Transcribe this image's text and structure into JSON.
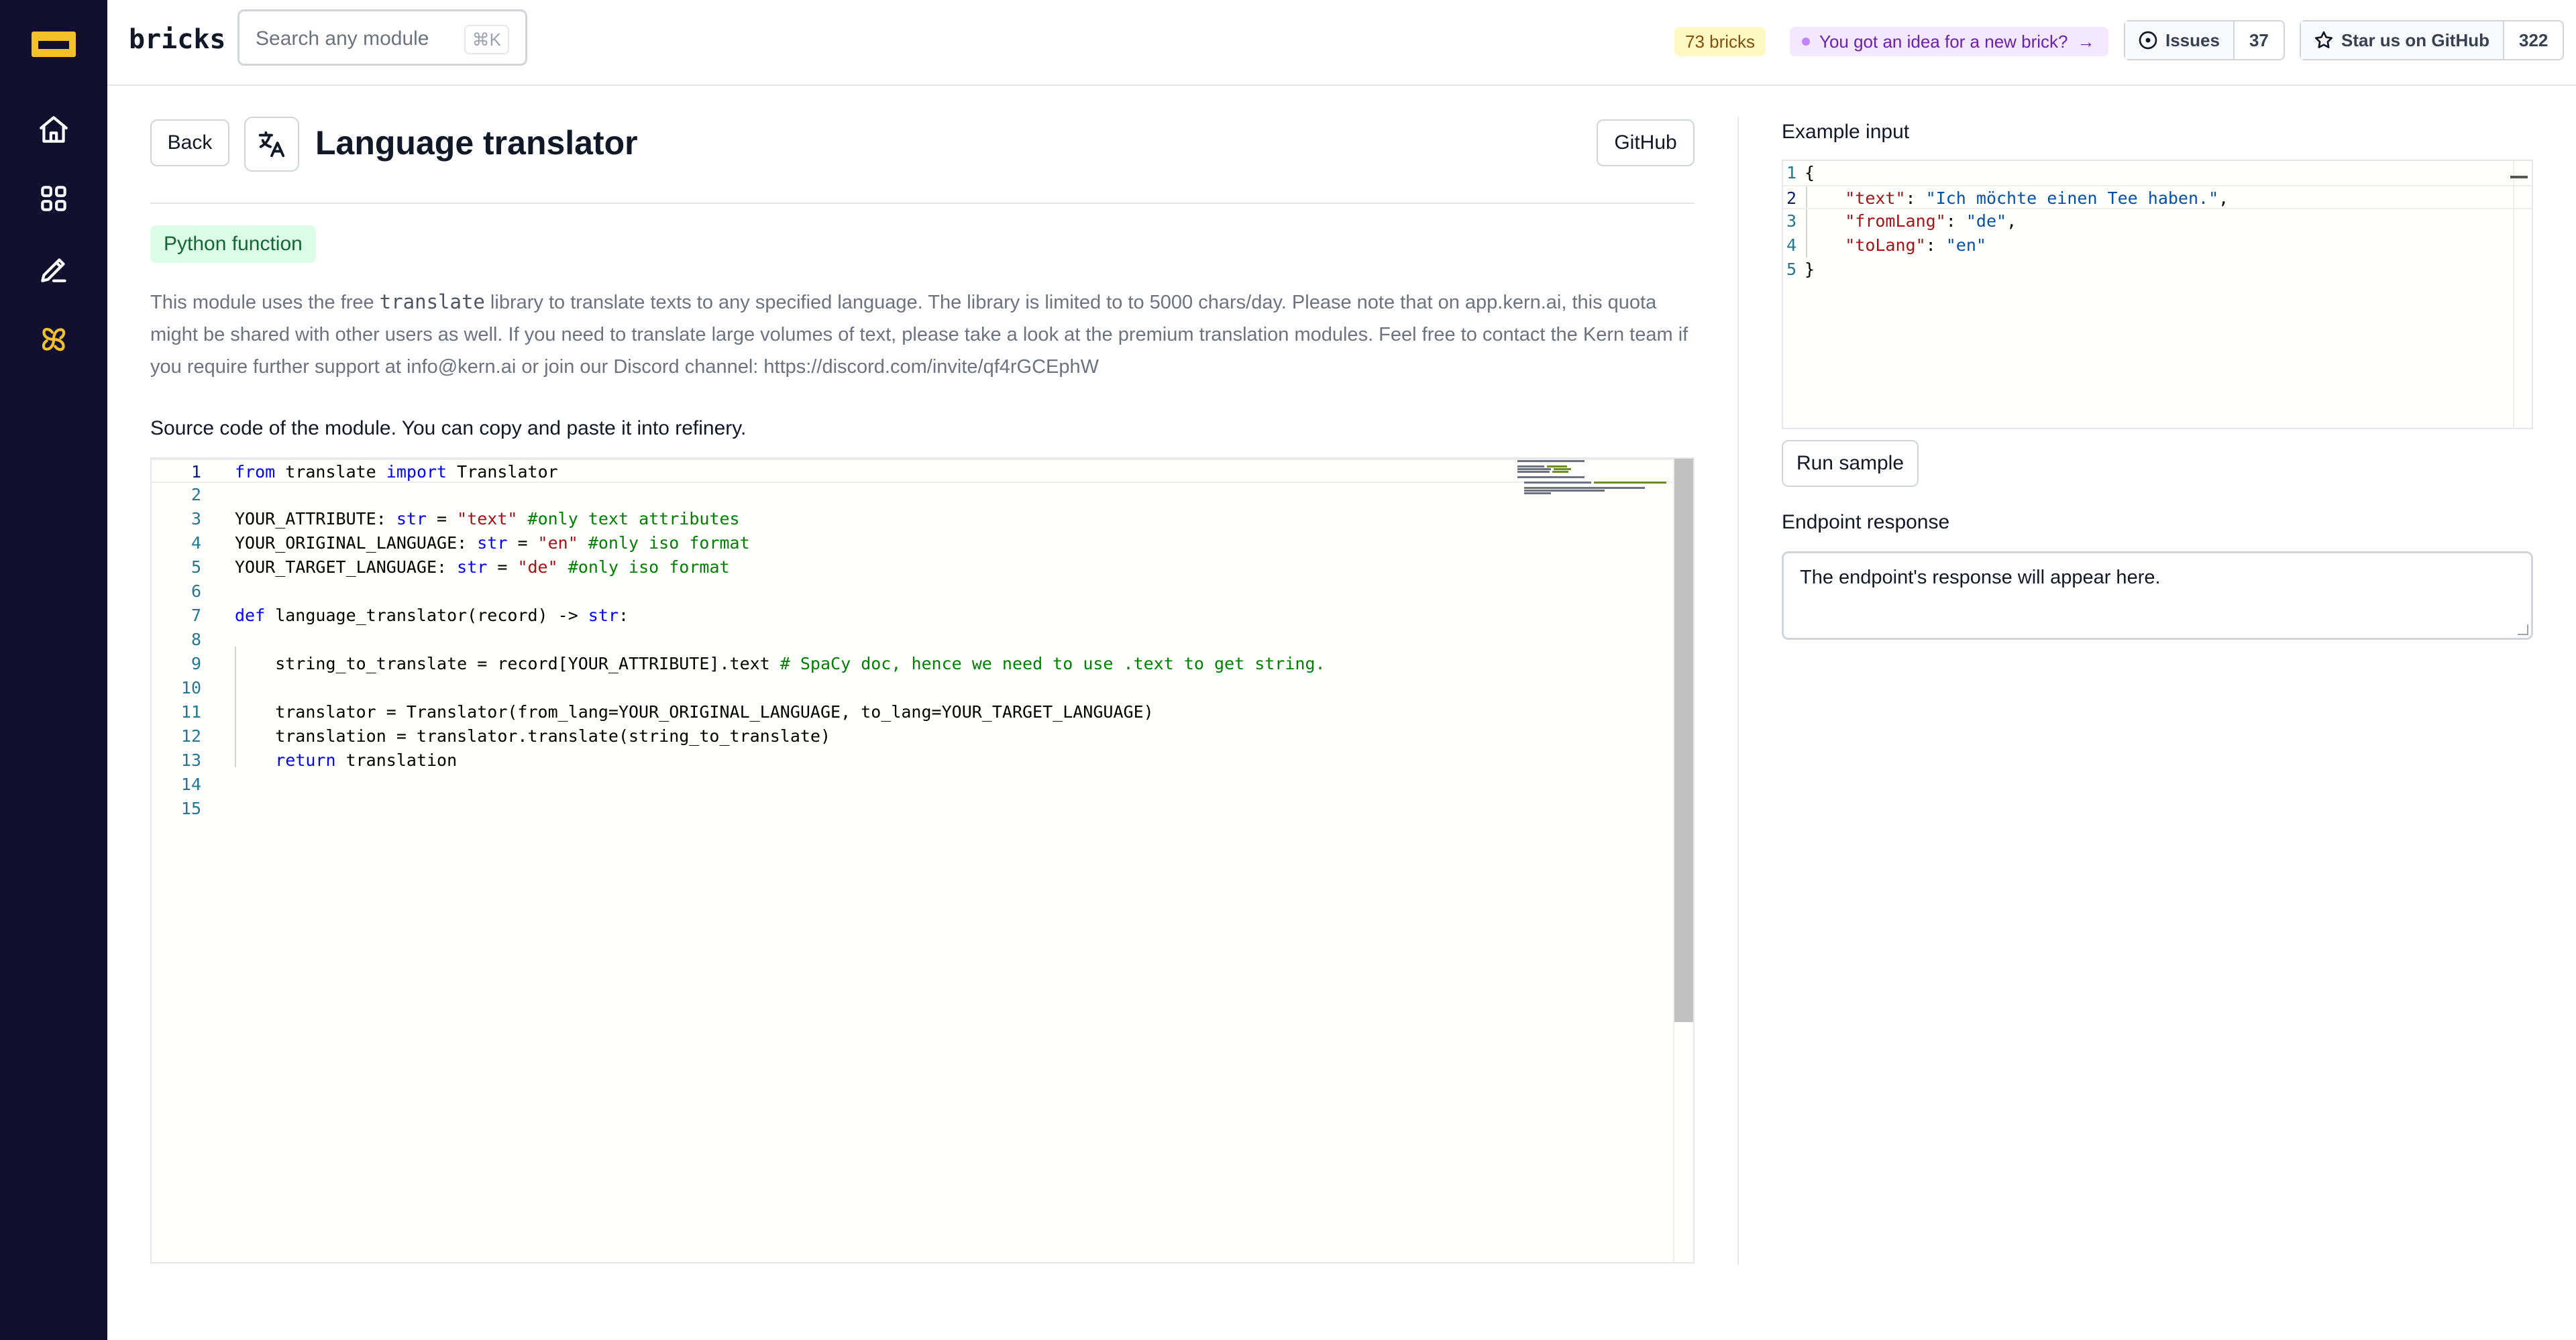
{
  "app": {
    "brand": "bricks"
  },
  "search": {
    "placeholder": "Search any module",
    "shortcut": "⌘K"
  },
  "header": {
    "bricks_count": "73 bricks",
    "idea_text": "You got an idea for a new brick?",
    "idea_arrow": "→",
    "issues_label": "Issues",
    "issues_count": "37",
    "star_label": "Star us on GitHub",
    "star_count": "322"
  },
  "sidebar": {
    "items": [
      {
        "icon": "logo-icon"
      },
      {
        "icon": "home-icon"
      },
      {
        "icon": "grid-icon"
      },
      {
        "icon": "pen-icon"
      },
      {
        "icon": "pinwheel-icon",
        "active": true
      }
    ],
    "accent_color": "#f3c22b",
    "background": "#120e2e"
  },
  "page": {
    "back_label": "Back",
    "title": "Language translator",
    "title_icon": "translate-icon",
    "github_label": "GitHub",
    "tag": "Python function",
    "description_before": "This module uses the free ",
    "description_code": "translate",
    "description_after": " library to translate texts to any specified language. The library is limited to to 5000 chars/day. Please note that on app.kern.ai, this quota might be shared with other users as well. If you need to translate large volumes of text, please take a look at the premium translation modules. Feel free to contact the Kern team if you require further support at info@kern.ai or join our Discord channel: https://discord.com/invite/qf4rGCEphW",
    "source_label": "Source code of the module. You can copy and paste it into refinery."
  },
  "code_editor": {
    "line_numbers": [
      "1",
      "2",
      "3",
      "4",
      "5",
      "6",
      "7",
      "8",
      "9",
      "10",
      "11",
      "12",
      "13",
      "14",
      "15"
    ],
    "active_line": 1,
    "lines": [
      [
        [
          "kw",
          "from"
        ],
        [
          "t",
          " translate "
        ],
        [
          "kw",
          "import"
        ],
        [
          "t",
          " Translator"
        ]
      ],
      [],
      [
        [
          "t",
          "YOUR_ATTRIBUTE: "
        ],
        [
          "kw",
          "str"
        ],
        [
          "t",
          " = "
        ],
        [
          "str",
          "\"text\""
        ],
        [
          "t",
          " "
        ],
        [
          "cm",
          "#only text attributes"
        ]
      ],
      [
        [
          "t",
          "YOUR_ORIGINAL_LANGUAGE: "
        ],
        [
          "kw",
          "str"
        ],
        [
          "t",
          " = "
        ],
        [
          "str",
          "\"en\""
        ],
        [
          "t",
          " "
        ],
        [
          "cm",
          "#only iso format"
        ]
      ],
      [
        [
          "t",
          "YOUR_TARGET_LANGUAGE: "
        ],
        [
          "kw",
          "str"
        ],
        [
          "t",
          " = "
        ],
        [
          "str",
          "\"de\""
        ],
        [
          "t",
          " "
        ],
        [
          "cm",
          "#only iso format"
        ]
      ],
      [],
      [
        [
          "kw",
          "def"
        ],
        [
          "t",
          " language_translator(record) -> "
        ],
        [
          "kw",
          "str"
        ],
        [
          "t",
          ":"
        ]
      ],
      [],
      [
        [
          "t",
          "    string_to_translate = record[YOUR_ATTRIBUTE].text "
        ],
        [
          "cm",
          "# SpaCy doc, hence we need to use .text to get string."
        ]
      ],
      [],
      [
        [
          "t",
          "    translator = Translator(from_lang=YOUR_ORIGINAL_LANGUAGE, to_lang=YOUR_TARGET_LANGUAGE)"
        ]
      ],
      [
        [
          "t",
          "    translation = translator.translate(string_to_translate)"
        ]
      ],
      [
        [
          "t",
          "    "
        ],
        [
          "kw",
          "return"
        ],
        [
          "t",
          " translation"
        ]
      ],
      [],
      []
    ]
  },
  "example_input": {
    "label": "Example input",
    "line_numbers": [
      "1",
      "2",
      "3",
      "4",
      "5"
    ],
    "active_line": 2,
    "lines": [
      [
        [
          "t",
          "{"
        ]
      ],
      [
        [
          "t",
          "    "
        ],
        [
          "jkey",
          "\"text\""
        ],
        [
          "t",
          ": "
        ],
        [
          "jval",
          "\"Ich möchte einen Tee haben.\""
        ],
        [
          "t",
          ","
        ]
      ],
      [
        [
          "t",
          "    "
        ],
        [
          "jkey",
          "\"fromLang\""
        ],
        [
          "t",
          ": "
        ],
        [
          "jval",
          "\"de\""
        ],
        [
          "t",
          ","
        ]
      ],
      [
        [
          "t",
          "    "
        ],
        [
          "jkey",
          "\"toLang\""
        ],
        [
          "t",
          ": "
        ],
        [
          "jval",
          "\"en\""
        ]
      ],
      [
        [
          "t",
          "}"
        ]
      ]
    ]
  },
  "run_sample_label": "Run sample",
  "endpoint": {
    "label": "Endpoint response",
    "placeholder": "The endpoint's response will appear here."
  }
}
